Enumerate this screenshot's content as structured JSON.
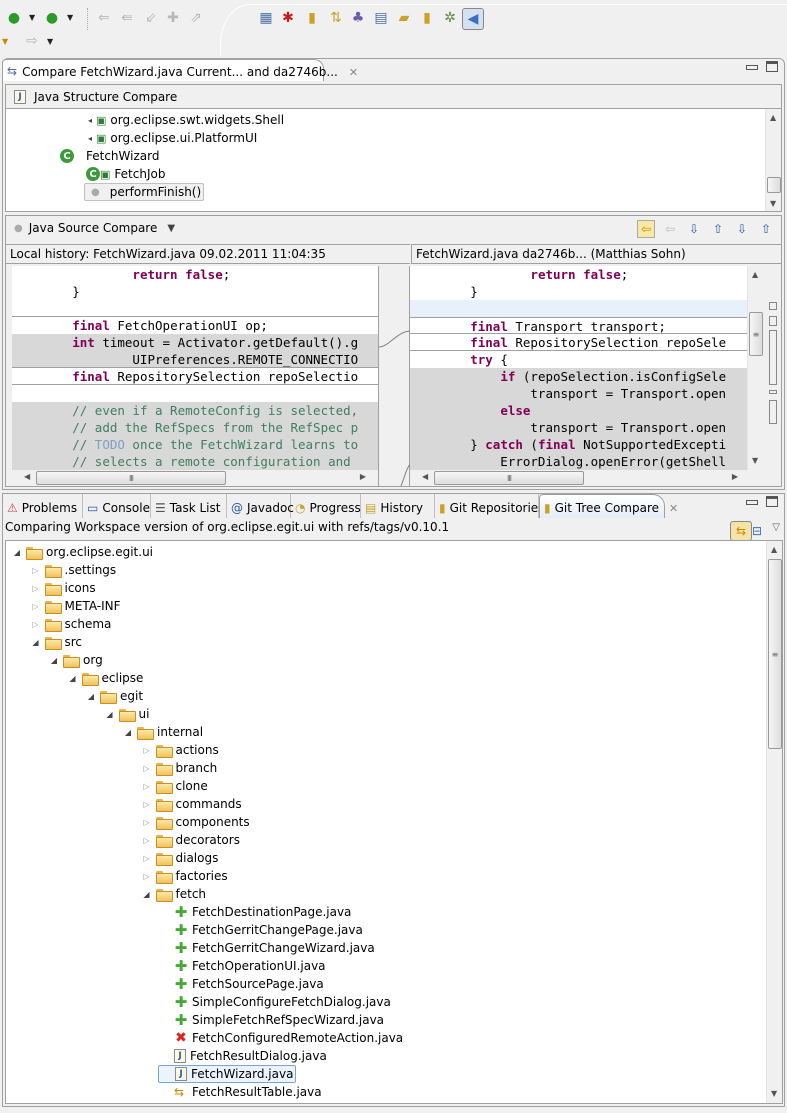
{
  "toolbar": {
    "buttons": [
      {
        "name": "run-icon",
        "glyph": "▶"
      },
      {
        "name": "external-tools-icon",
        "glyph": "⚙"
      },
      {
        "name": "nav-back-icon",
        "glyph": "⇦"
      },
      {
        "name": "nav-forward-icon",
        "glyph": "⇨"
      }
    ],
    "perspectives": [
      "New Perspective",
      "Debug",
      "Git Repository Exploring",
      "Team Synchronizing",
      "Plug-in Development",
      "Resource",
      "Java Browsing",
      "CVS Repository Exploring",
      "Debug2",
      "Compare"
    ]
  },
  "editor": {
    "tab_title": "Compare FetchWizard.java Current... and da2746b...",
    "close_glyph": "✕",
    "structure_compare": {
      "title": "Java Structure Compare",
      "items": [
        {
          "label": "org.eclipse.swt.widgets.Shell",
          "kind": "import"
        },
        {
          "label": "org.eclipse.ui.PlatformUI",
          "kind": "import"
        },
        {
          "label": "FetchWizard",
          "kind": "class"
        },
        {
          "label": "FetchJob",
          "kind": "inner-class"
        },
        {
          "label": "performFinish()",
          "kind": "method",
          "selected": true
        }
      ]
    },
    "source_compare": {
      "title": "Java Source Compare",
      "left_header": "Local history: FetchWizard.java 09.02.2011 11:04:35",
      "right_header": "FetchWizard.java da2746b... (Matthias Sohn)",
      "left_lines": [
        "                return false;",
        "        }",
        "",
        "        final FetchOperationUI op;",
        "        int timeout = Activator.getDefault().g",
        "                UIPreferences.REMOTE_CONNECTIO",
        "        final RepositorySelection repoSelectio",
        "",
        "        // even if a RemoteConfig is selected,",
        "        // add the RefSpecs from the RefSpec p",
        "        // TODO once the FetchWizard learns to",
        "        // selects a remote configuration and "
      ],
      "right_lines": [
        "                return false;",
        "        }",
        "",
        "        final Transport transport;",
        "        final RepositorySelection repoSele",
        "        try {",
        "            if (repoSelection.isConfigSele",
        "                transport = Transport.open",
        "            else",
        "                transport = Transport.open",
        "        } catch (final NotSupportedExcepti",
        "            ErrorDialog.openError(getShell"
      ]
    }
  },
  "bottom": {
    "tabs": [
      {
        "label": "Problems",
        "icon": "problems-icon"
      },
      {
        "label": "Console",
        "icon": "console-icon"
      },
      {
        "label": "Task List",
        "icon": "task-list-icon"
      },
      {
        "label": "Javadoc",
        "icon": "javadoc-icon"
      },
      {
        "label": "Progress",
        "icon": "progress-icon"
      },
      {
        "label": "History",
        "icon": "history-icon"
      },
      {
        "label": "Git Repositories",
        "icon": "git-repositories-icon"
      },
      {
        "label": "Git Tree Compare",
        "icon": "git-tree-compare-icon",
        "active": true
      }
    ],
    "comparing_label": "Comparing Workspace version of org.eclipse.egit.ui with refs/tags/v0.10.1",
    "tree": [
      {
        "label": "org.eclipse.egit.ui",
        "depth": 0,
        "type": "project",
        "expanded": true
      },
      {
        "label": ".settings",
        "depth": 1,
        "type": "folder",
        "expanded": false
      },
      {
        "label": "icons",
        "depth": 1,
        "type": "folder",
        "expanded": false
      },
      {
        "label": "META-INF",
        "depth": 1,
        "type": "folder",
        "expanded": false
      },
      {
        "label": "schema",
        "depth": 1,
        "type": "folder",
        "expanded": false
      },
      {
        "label": "src",
        "depth": 1,
        "type": "folder",
        "expanded": true
      },
      {
        "label": "org",
        "depth": 2,
        "type": "folder",
        "expanded": true
      },
      {
        "label": "eclipse",
        "depth": 3,
        "type": "folder",
        "expanded": true
      },
      {
        "label": "egit",
        "depth": 4,
        "type": "folder",
        "expanded": true
      },
      {
        "label": "ui",
        "depth": 5,
        "type": "folder",
        "expanded": true
      },
      {
        "label": "internal",
        "depth": 6,
        "type": "folder",
        "expanded": true
      },
      {
        "label": "actions",
        "depth": 7,
        "type": "folder",
        "expanded": false
      },
      {
        "label": "branch",
        "depth": 7,
        "type": "folder",
        "expanded": false
      },
      {
        "label": "clone",
        "depth": 7,
        "type": "folder",
        "expanded": false
      },
      {
        "label": "commands",
        "depth": 7,
        "type": "folder",
        "expanded": false
      },
      {
        "label": "components",
        "depth": 7,
        "type": "folder",
        "expanded": false
      },
      {
        "label": "decorators",
        "depth": 7,
        "type": "folder",
        "expanded": false
      },
      {
        "label": "dialogs",
        "depth": 7,
        "type": "folder",
        "expanded": false
      },
      {
        "label": "factories",
        "depth": 7,
        "type": "folder",
        "expanded": false
      },
      {
        "label": "fetch",
        "depth": 7,
        "type": "folder",
        "expanded": true
      },
      {
        "label": "FetchDestinationPage.java",
        "depth": 8,
        "type": "added"
      },
      {
        "label": "FetchGerritChangePage.java",
        "depth": 8,
        "type": "added"
      },
      {
        "label": "FetchGerritChangeWizard.java",
        "depth": 8,
        "type": "added"
      },
      {
        "label": "FetchOperationUI.java",
        "depth": 8,
        "type": "added"
      },
      {
        "label": "FetchSourcePage.java",
        "depth": 8,
        "type": "added"
      },
      {
        "label": "SimpleConfigureFetchDialog.java",
        "depth": 8,
        "type": "added"
      },
      {
        "label": "SimpleFetchRefSpecWizard.java",
        "depth": 8,
        "type": "added"
      },
      {
        "label": "FetchConfiguredRemoteAction.java",
        "depth": 8,
        "type": "deleted"
      },
      {
        "label": "FetchResultDialog.java",
        "depth": 8,
        "type": "java"
      },
      {
        "label": "FetchWizard.java",
        "depth": 8,
        "type": "java",
        "selected": true
      },
      {
        "label": "FetchResultTable.java",
        "depth": 8,
        "type": "changed"
      }
    ]
  }
}
